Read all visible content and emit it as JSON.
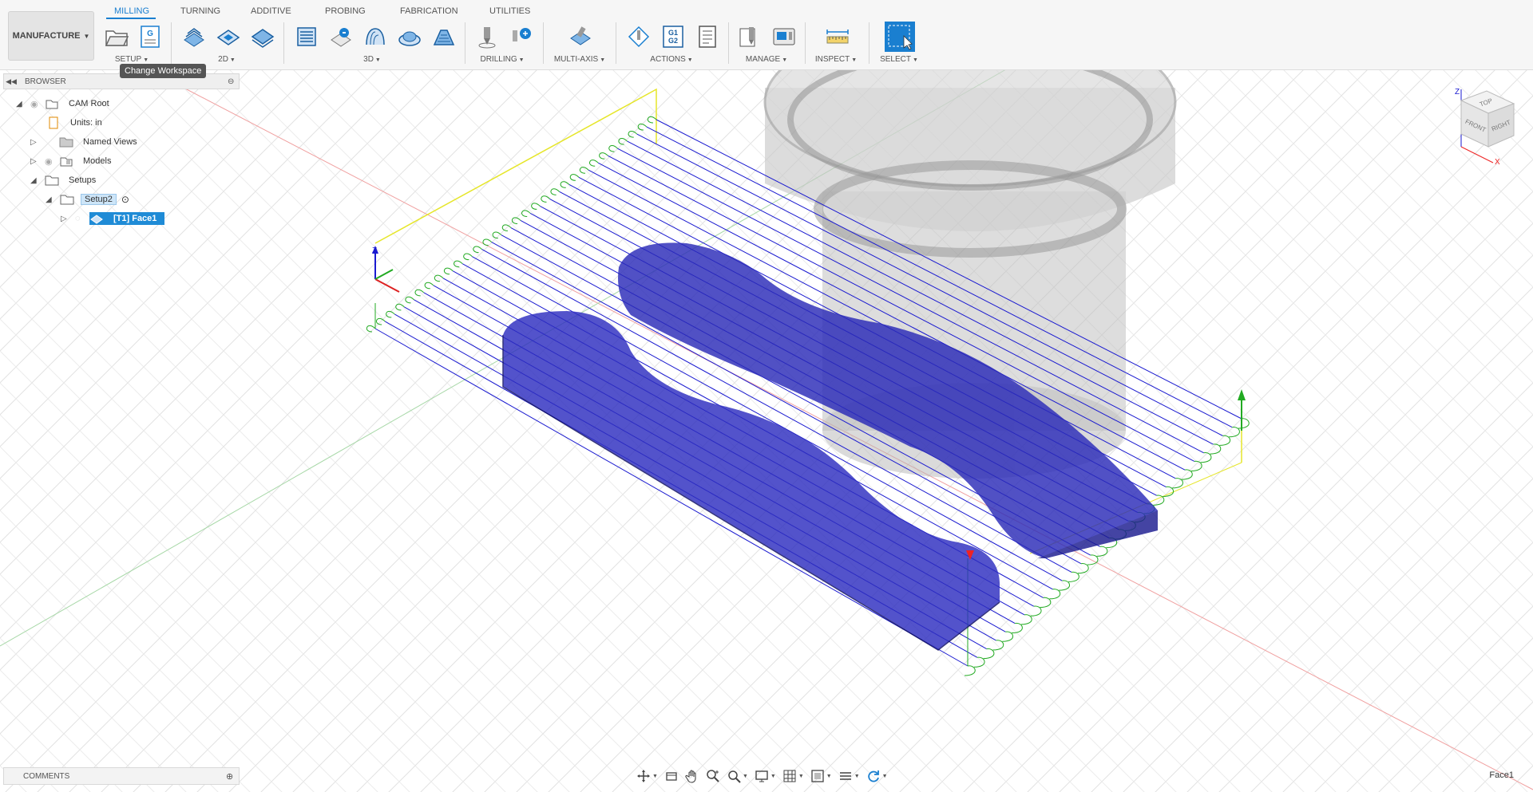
{
  "app": {
    "workspace_button": "MANUFACTURE"
  },
  "tabs": [
    "MILLING",
    "TURNING",
    "ADDITIVE",
    "PROBING",
    "FABRICATION",
    "UTILITIES"
  ],
  "active_tab": "MILLING",
  "toolbar_groups": {
    "setup": "SETUP",
    "twod": "2D",
    "threed": "3D",
    "drilling": "DRILLING",
    "multiaxis": "MULTI-AXIS",
    "actions": "ACTIONS",
    "manage": "MANAGE",
    "inspect": "INSPECT",
    "select": "SELECT"
  },
  "tooltip": "Change Workspace",
  "gcode_icon_text": {
    "g": "G",
    "g1": "G1",
    "g2": "G2"
  },
  "browser": {
    "title": "BROWSER",
    "items": {
      "cam_root": "CAM Root",
      "units": "Units: in",
      "named_views": "Named Views",
      "models": "Models",
      "setups": "Setups",
      "setup2": "Setup2",
      "face1": "[T1] Face1"
    }
  },
  "comments": {
    "title": "COMMENTS"
  },
  "status": {
    "selection": "Face1"
  },
  "viewcube": {
    "top": "TOP",
    "front": "FRONT",
    "right": "RIGHT",
    "axis_z": "Z",
    "axis_x": "X"
  },
  "triad": {
    "z": "Z"
  },
  "colors": {
    "accent": "#1a7fd0",
    "toolpath_cut": "#1a1ad0",
    "toolpath_link": "#22aa22",
    "stock_box": "#e8e830",
    "part_fill": "#2b2bb8"
  }
}
